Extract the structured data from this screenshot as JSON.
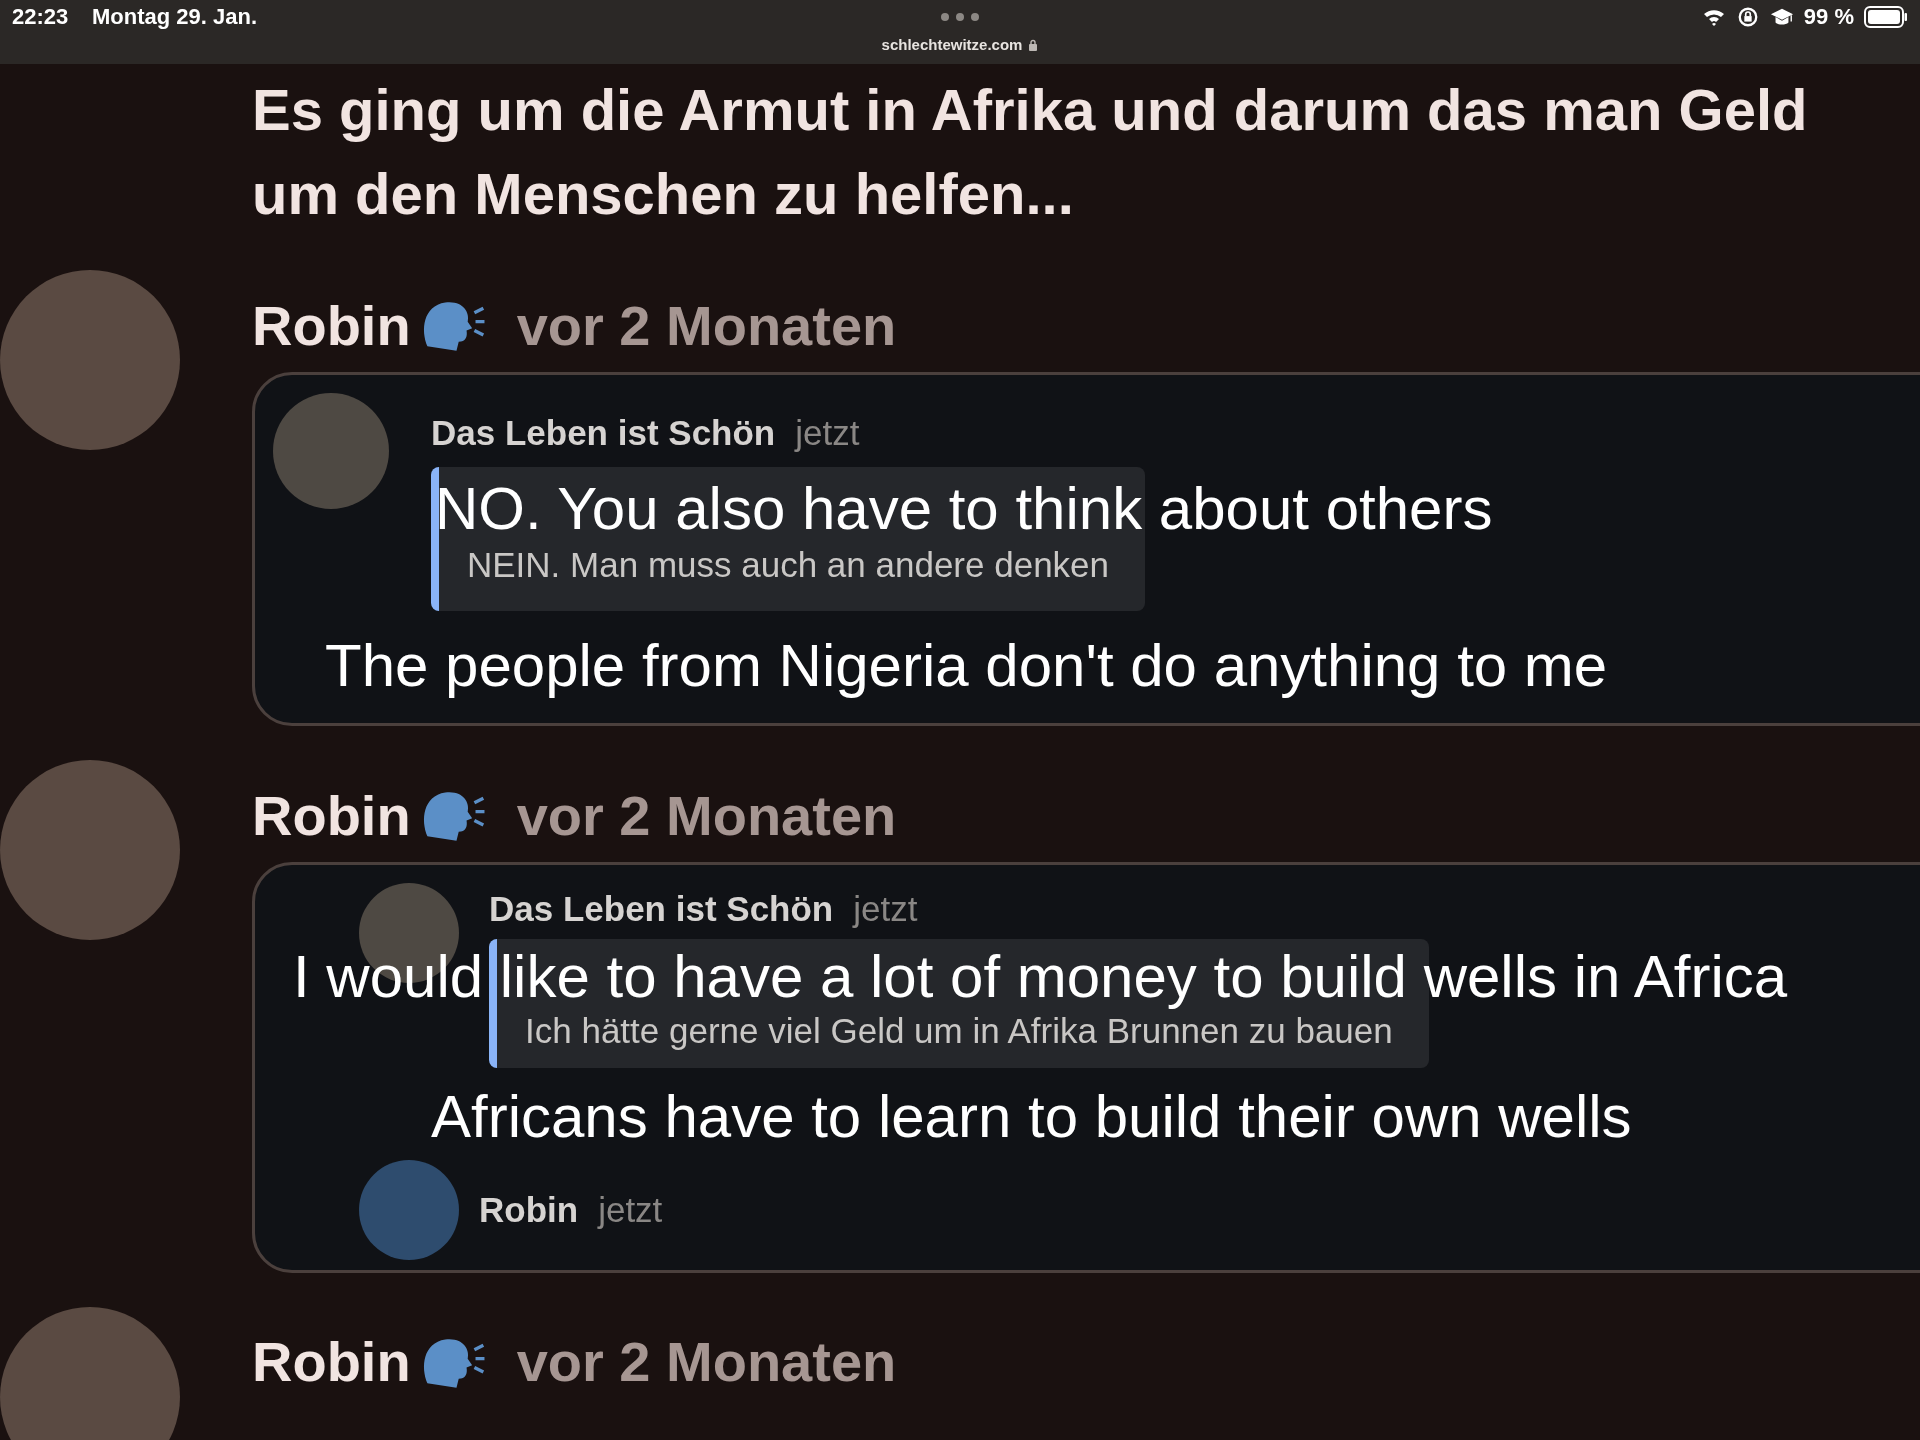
{
  "status_bar": {
    "time": "22:23",
    "date": "Montag 29. Jan.",
    "battery": "99 %"
  },
  "address_bar": {
    "url": "schlechtewitze.com"
  },
  "intro_lines": [
    "Es ging um die Armut in Afrika und darum das man Geld",
    "um den Menschen zu helfen..."
  ],
  "posts": [
    {
      "author": "Robin",
      "time": "vor 2 Monaten",
      "reply": {
        "author": "Das Leben ist Schön",
        "time": "jetzt",
        "quote": {
          "text": "NEIN. Man muss auch an andere denken",
          "translation": "NO. You also have to think about others"
        },
        "translation": "The people from Nigeria don't do anything to me"
      }
    },
    {
      "author": "Robin",
      "time": "vor 2 Monaten",
      "reply": {
        "author": "Das Leben ist Schön",
        "time": "jetzt",
        "quote": {
          "text": "Ich hätte gerne viel Geld um in Afrika Brunnen zu bauen",
          "translation": "I would like to have a lot of money to build wells in Africa"
        },
        "translation": "Africans have to learn to build their own wells"
      },
      "next_reply": {
        "author": "Robin",
        "time": "jetzt"
      }
    },
    {
      "author": "Robin",
      "time": "vor 2 Monaten"
    }
  ]
}
